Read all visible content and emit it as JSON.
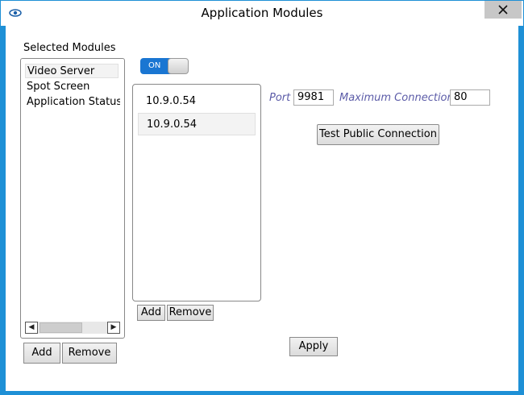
{
  "window": {
    "title": "Application Modules",
    "icon": "eye-icon"
  },
  "modules": {
    "label": "Selected Modules",
    "items": [
      "Video Server",
      "Spot Screen",
      "Application Status I"
    ],
    "selected": "Video Server",
    "add_label": "Add",
    "remove_label": "Remove"
  },
  "toggle": {
    "label": "ON",
    "state": "on"
  },
  "ips": {
    "items": [
      "10.9.0.54",
      "10.9.0.54"
    ],
    "add_label": "Add",
    "remove_label": "Remove"
  },
  "connection": {
    "port_label": "Port",
    "port_value": "9981",
    "max_label": "Maximum Connections",
    "max_value": "80",
    "test_label": "Test Public Connection"
  },
  "apply_label": "Apply",
  "colors": {
    "accent": "#1e90d6",
    "toggle_on": "#1a76d2",
    "italic_label": "#5c5ca8"
  }
}
